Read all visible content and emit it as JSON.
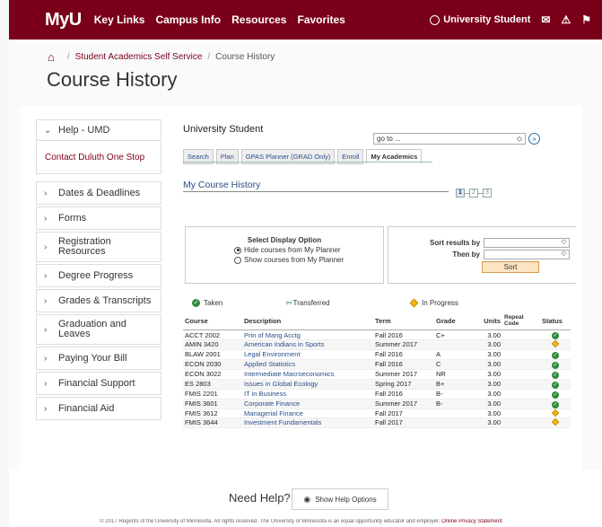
{
  "header": {
    "logo": "MyU",
    "nav": [
      "Key Links",
      "Campus Info",
      "Resources",
      "Favorites"
    ],
    "user": "University Student"
  },
  "breadcrumb": {
    "parent": "Student Academics Self Service",
    "current": "Course History"
  },
  "page_title": "Course History",
  "sidebar": {
    "help_label": "Help - UMD",
    "help_link": "Contact Duluth One Stop",
    "items": [
      "Dates & Deadlines",
      "Forms",
      "Registration Resources",
      "Degree Progress",
      "Grades & Transcripts",
      "Graduation and Leaves",
      "Paying Your Bill",
      "Financial Support",
      "Financial Aid"
    ]
  },
  "content": {
    "student_name": "University Student",
    "goto_value": "go to ...",
    "tabs": [
      "Search",
      "Plan",
      "GPAS Planner (GRAD Only)",
      "Enroll",
      "My Academics"
    ],
    "section_title": "My Course History",
    "pager": [
      "1",
      "2",
      "3"
    ],
    "display_option": {
      "title": "Select Display Option",
      "hide": "Hide courses from My Planner",
      "show": "Show courses from My Planner",
      "selected": "hide"
    },
    "sort": {
      "sort_by_label": "Sort results by",
      "then_by_label": "Then by",
      "button": "Sort"
    },
    "legend": {
      "taken": "Taken",
      "transferred": "Transferred",
      "in_progress": "In Progress"
    },
    "table": {
      "headers": {
        "course": "Course",
        "description": "Description",
        "term": "Term",
        "grade": "Grade",
        "units": "Units",
        "repeat": "Repeat Code",
        "status": "Status"
      },
      "rows": [
        {
          "course": "ACCT 2002",
          "description": "Prin of Mang Acctg",
          "term": "Fall 2016",
          "grade": "C+",
          "units": "3.00",
          "status": "taken"
        },
        {
          "course": "AMIN 3420",
          "description": "American Indians in Sports",
          "term": "Summer 2017",
          "grade": "",
          "units": "3.00",
          "status": "in_progress"
        },
        {
          "course": "BLAW 2001",
          "description": "Legal Environment",
          "term": "Fall 2016",
          "grade": "A",
          "units": "3.00",
          "status": "taken"
        },
        {
          "course": "ECON 2030",
          "description": "Applied Statistics",
          "term": "Fall 2016",
          "grade": "C",
          "units": "3.00",
          "status": "taken"
        },
        {
          "course": "ECON 3022",
          "description": "Intermediate Macroeconomics",
          "term": "Summer 2017",
          "grade": "NR",
          "units": "3.00",
          "status": "taken"
        },
        {
          "course": "ES 2803",
          "description": "Issues in Global Ecology",
          "term": "Spring 2017",
          "grade": "B+",
          "units": "3.00",
          "status": "taken"
        },
        {
          "course": "FMIS 2201",
          "description": "IT in Business",
          "term": "Fall 2016",
          "grade": "B-",
          "units": "3.00",
          "status": "taken"
        },
        {
          "course": "FMIS 3601",
          "description": "Corporate Finance",
          "term": "Summer 2017",
          "grade": "B-",
          "units": "3.00",
          "status": "taken"
        },
        {
          "course": "FMIS 3612",
          "description": "Managerial Finance",
          "term": "Fall 2017",
          "grade": "",
          "units": "3.00",
          "status": "in_progress"
        },
        {
          "course": "FMIS 3644",
          "description": "Investment Fundamentals",
          "term": "Fall 2017",
          "grade": "",
          "units": "3.00",
          "status": "in_progress"
        }
      ]
    }
  },
  "help": {
    "need_help": "Need Help?",
    "show_options": "Show Help Options"
  },
  "footer": {
    "text": "© 2017 Regents of the University of Minnesota. All rights reserved. The University of Minnesota is an equal opportunity educator and employer.",
    "privacy": "Online Privacy Statement"
  },
  "colors": {
    "maroon": "#7a0019",
    "gold": "#f3c64a",
    "link_blue": "#2a4e8a"
  }
}
